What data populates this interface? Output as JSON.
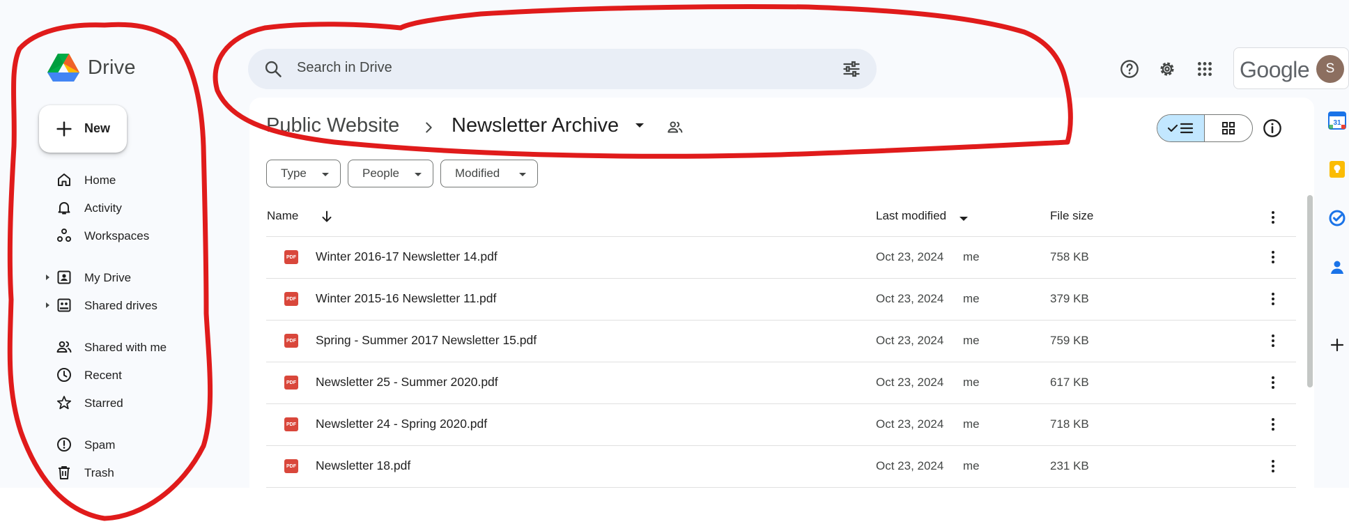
{
  "app": {
    "name": "Drive"
  },
  "search": {
    "placeholder": "Search in Drive"
  },
  "account": {
    "brand": "Google",
    "avatar_initial": "S",
    "avatar_color": "#8c6f60"
  },
  "sidebar": {
    "new_label": "New",
    "items": [
      {
        "label": "Home",
        "icon": "home-icon"
      },
      {
        "label": "Activity",
        "icon": "bell-icon"
      },
      {
        "label": "Workspaces",
        "icon": "workspaces-icon"
      },
      {
        "label": "My Drive",
        "icon": "my-drive-icon"
      },
      {
        "label": "Shared drives",
        "icon": "shared-drives-icon"
      },
      {
        "label": "Shared with me",
        "icon": "people-icon"
      },
      {
        "label": "Recent",
        "icon": "clock-icon"
      },
      {
        "label": "Starred",
        "icon": "star-icon"
      },
      {
        "label": "Spam",
        "icon": "spam-icon"
      },
      {
        "label": "Trash",
        "icon": "trash-icon"
      }
    ]
  },
  "breadcrumb": {
    "root": "Public Website",
    "current": "Newsletter Archive"
  },
  "filters": [
    {
      "label": "Type"
    },
    {
      "label": "People"
    },
    {
      "label": "Modified"
    }
  ],
  "table": {
    "headers": {
      "name": "Name",
      "modified": "Last modified",
      "size": "File size"
    },
    "rows": [
      {
        "name": "Winter 2016-17 Newsletter 14.pdf",
        "date": "Oct 23, 2024",
        "owner": "me",
        "size": "758 KB",
        "type": "PDF"
      },
      {
        "name": "Winter 2015-16 Newsletter 11.pdf",
        "date": "Oct 23, 2024",
        "owner": "me",
        "size": "379 KB",
        "type": "PDF"
      },
      {
        "name": "Spring - Summer 2017 Newsletter 15.pdf",
        "date": "Oct 23, 2024",
        "owner": "me",
        "size": "759 KB",
        "type": "PDF"
      },
      {
        "name": "Newsletter 25 - Summer 2020.pdf",
        "date": "Oct 23, 2024",
        "owner": "me",
        "size": "617 KB",
        "type": "PDF"
      },
      {
        "name": "Newsletter 24 - Spring 2020.pdf",
        "date": "Oct 23, 2024",
        "owner": "me",
        "size": "718 KB",
        "type": "PDF"
      },
      {
        "name": "Newsletter 18.pdf",
        "date": "Oct 23, 2024",
        "owner": "me",
        "size": "231 KB",
        "type": "PDF"
      }
    ]
  },
  "side_panel": {
    "calendar_date": "31"
  },
  "colors": {
    "accent": "#0b57d0",
    "annotation": "#e01b1b",
    "pdf": "#d9473b",
    "toggle_selected": "#c2e7ff"
  }
}
